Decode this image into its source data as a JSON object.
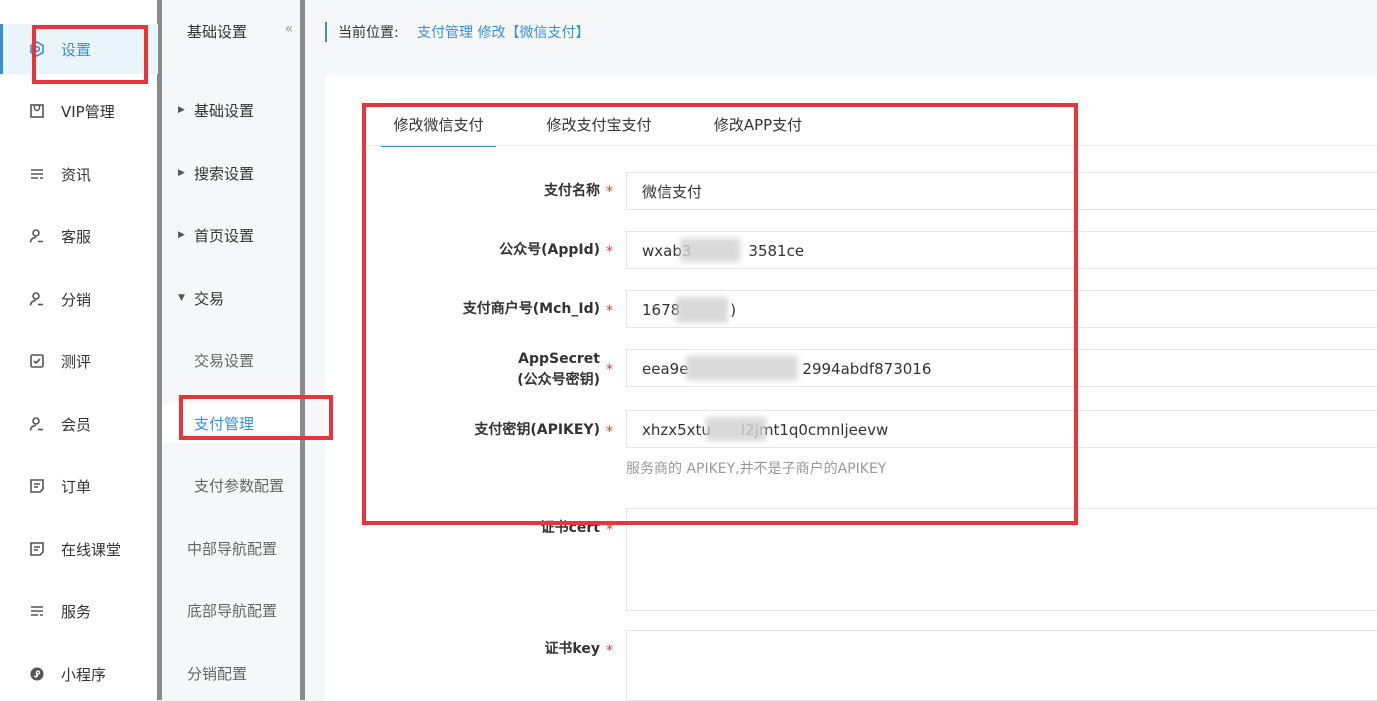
{
  "sidebar": {
    "items": [
      {
        "label": "设置",
        "icon": "gear-icon",
        "active": true
      },
      {
        "label": "VIP管理",
        "icon": "bag-icon"
      },
      {
        "label": "资讯",
        "icon": "list-icon"
      },
      {
        "label": "客服",
        "icon": "user-icon"
      },
      {
        "label": "分销",
        "icon": "user-icon"
      },
      {
        "label": "测评",
        "icon": "check-icon"
      },
      {
        "label": "会员",
        "icon": "user-icon"
      },
      {
        "label": "订单",
        "icon": "doc-icon"
      },
      {
        "label": "在线课堂",
        "icon": "doc-icon"
      },
      {
        "label": "服务",
        "icon": "list-icon"
      },
      {
        "label": "小程序",
        "icon": "miniapp-icon"
      }
    ]
  },
  "subnav": {
    "title": "基础设置",
    "collapse_icon": "«",
    "items": [
      {
        "label": "基础设置",
        "type": "group",
        "expanded": false
      },
      {
        "label": "搜索设置",
        "type": "group",
        "expanded": false
      },
      {
        "label": "首页设置",
        "type": "group",
        "expanded": false
      },
      {
        "label": "交易",
        "type": "group",
        "expanded": true
      },
      {
        "label": "交易设置",
        "type": "sub"
      },
      {
        "label": "支付管理",
        "type": "sub",
        "active": true
      },
      {
        "label": "支付参数配置",
        "type": "sub"
      },
      {
        "label": "中部导航配置",
        "type": "top"
      },
      {
        "label": "底部导航配置",
        "type": "top"
      },
      {
        "label": "分销配置",
        "type": "top"
      }
    ]
  },
  "breadcrumb": {
    "prefix": "当前位置:",
    "path": "支付管理 修改【微信支付】"
  },
  "tabs": [
    {
      "label": "修改微信支付",
      "active": true
    },
    {
      "label": "修改支付宝支付"
    },
    {
      "label": "修改APP支付"
    }
  ],
  "form": {
    "required_mark": "*",
    "fields": {
      "pay_name": {
        "label": "支付名称",
        "value": "微信支付"
      },
      "appid": {
        "label": "公众号(AppId)",
        "value_start": "wxab3",
        "value_end": "3581ce"
      },
      "mch_id": {
        "label": "支付商户号(Mch_Id)",
        "value_start": "1678",
        "value_end": ")"
      },
      "appsecret": {
        "label_line1": "AppSecret",
        "label_line2": "(公众号密钥)",
        "value_start": "eea9e",
        "value_end": "2994abdf873016"
      },
      "apikey": {
        "label": "支付密钥(APIKEY)",
        "value_start": "xhzx5xtu",
        "value_end": "l2jmt1q0cmnljeevw",
        "hint": "服务商的 APIKEY,并不是子商户的APIKEY"
      },
      "cert": {
        "label": "证书cert"
      },
      "key": {
        "label": "证书key"
      }
    }
  },
  "colors": {
    "accent": "#3a8fd9",
    "highlight": "#e8343a",
    "required": "#e33333"
  }
}
